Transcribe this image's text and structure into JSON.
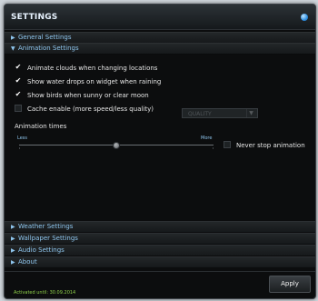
{
  "window": {
    "title": "SETTINGS"
  },
  "sections": {
    "general": {
      "arrow": "▶",
      "label": "General Settings"
    },
    "animation": {
      "arrow": "▼",
      "label": "Animation Settings"
    },
    "weather": {
      "arrow": "▶",
      "label": "Weather Settings"
    },
    "wallpaper": {
      "arrow": "▶",
      "label": "Wallpaper Settings"
    },
    "audio": {
      "arrow": "▶",
      "label": "Audio Settings"
    },
    "about": {
      "arrow": "▶",
      "label": "About"
    }
  },
  "animation": {
    "options": [
      {
        "label": "Animate clouds when changing locations",
        "checked": true,
        "mark": "✔"
      },
      {
        "label": "Show water drops on widget when raining",
        "checked": true,
        "mark": "✔"
      },
      {
        "label": "Show birds when sunny or clear moon",
        "checked": true,
        "mark": "✔"
      },
      {
        "label": "Cache enable (more speed/less quality)",
        "checked": false,
        "mark": ""
      }
    ],
    "quality_select": {
      "value": "QUALITY",
      "caret": "▼"
    },
    "times_title": "Animation times",
    "slider": {
      "min_label": "Less",
      "max_label": "More",
      "value": 0.5
    },
    "never_stop": {
      "label": "Never stop animation",
      "checked": false
    }
  },
  "footer": {
    "apply_label": "Apply",
    "activated_text": "Activated until: 30.09.2014"
  },
  "colors": {
    "accent": "#8fc6ee",
    "status_green": "#8fd04a",
    "background": "#0c0d0e"
  }
}
